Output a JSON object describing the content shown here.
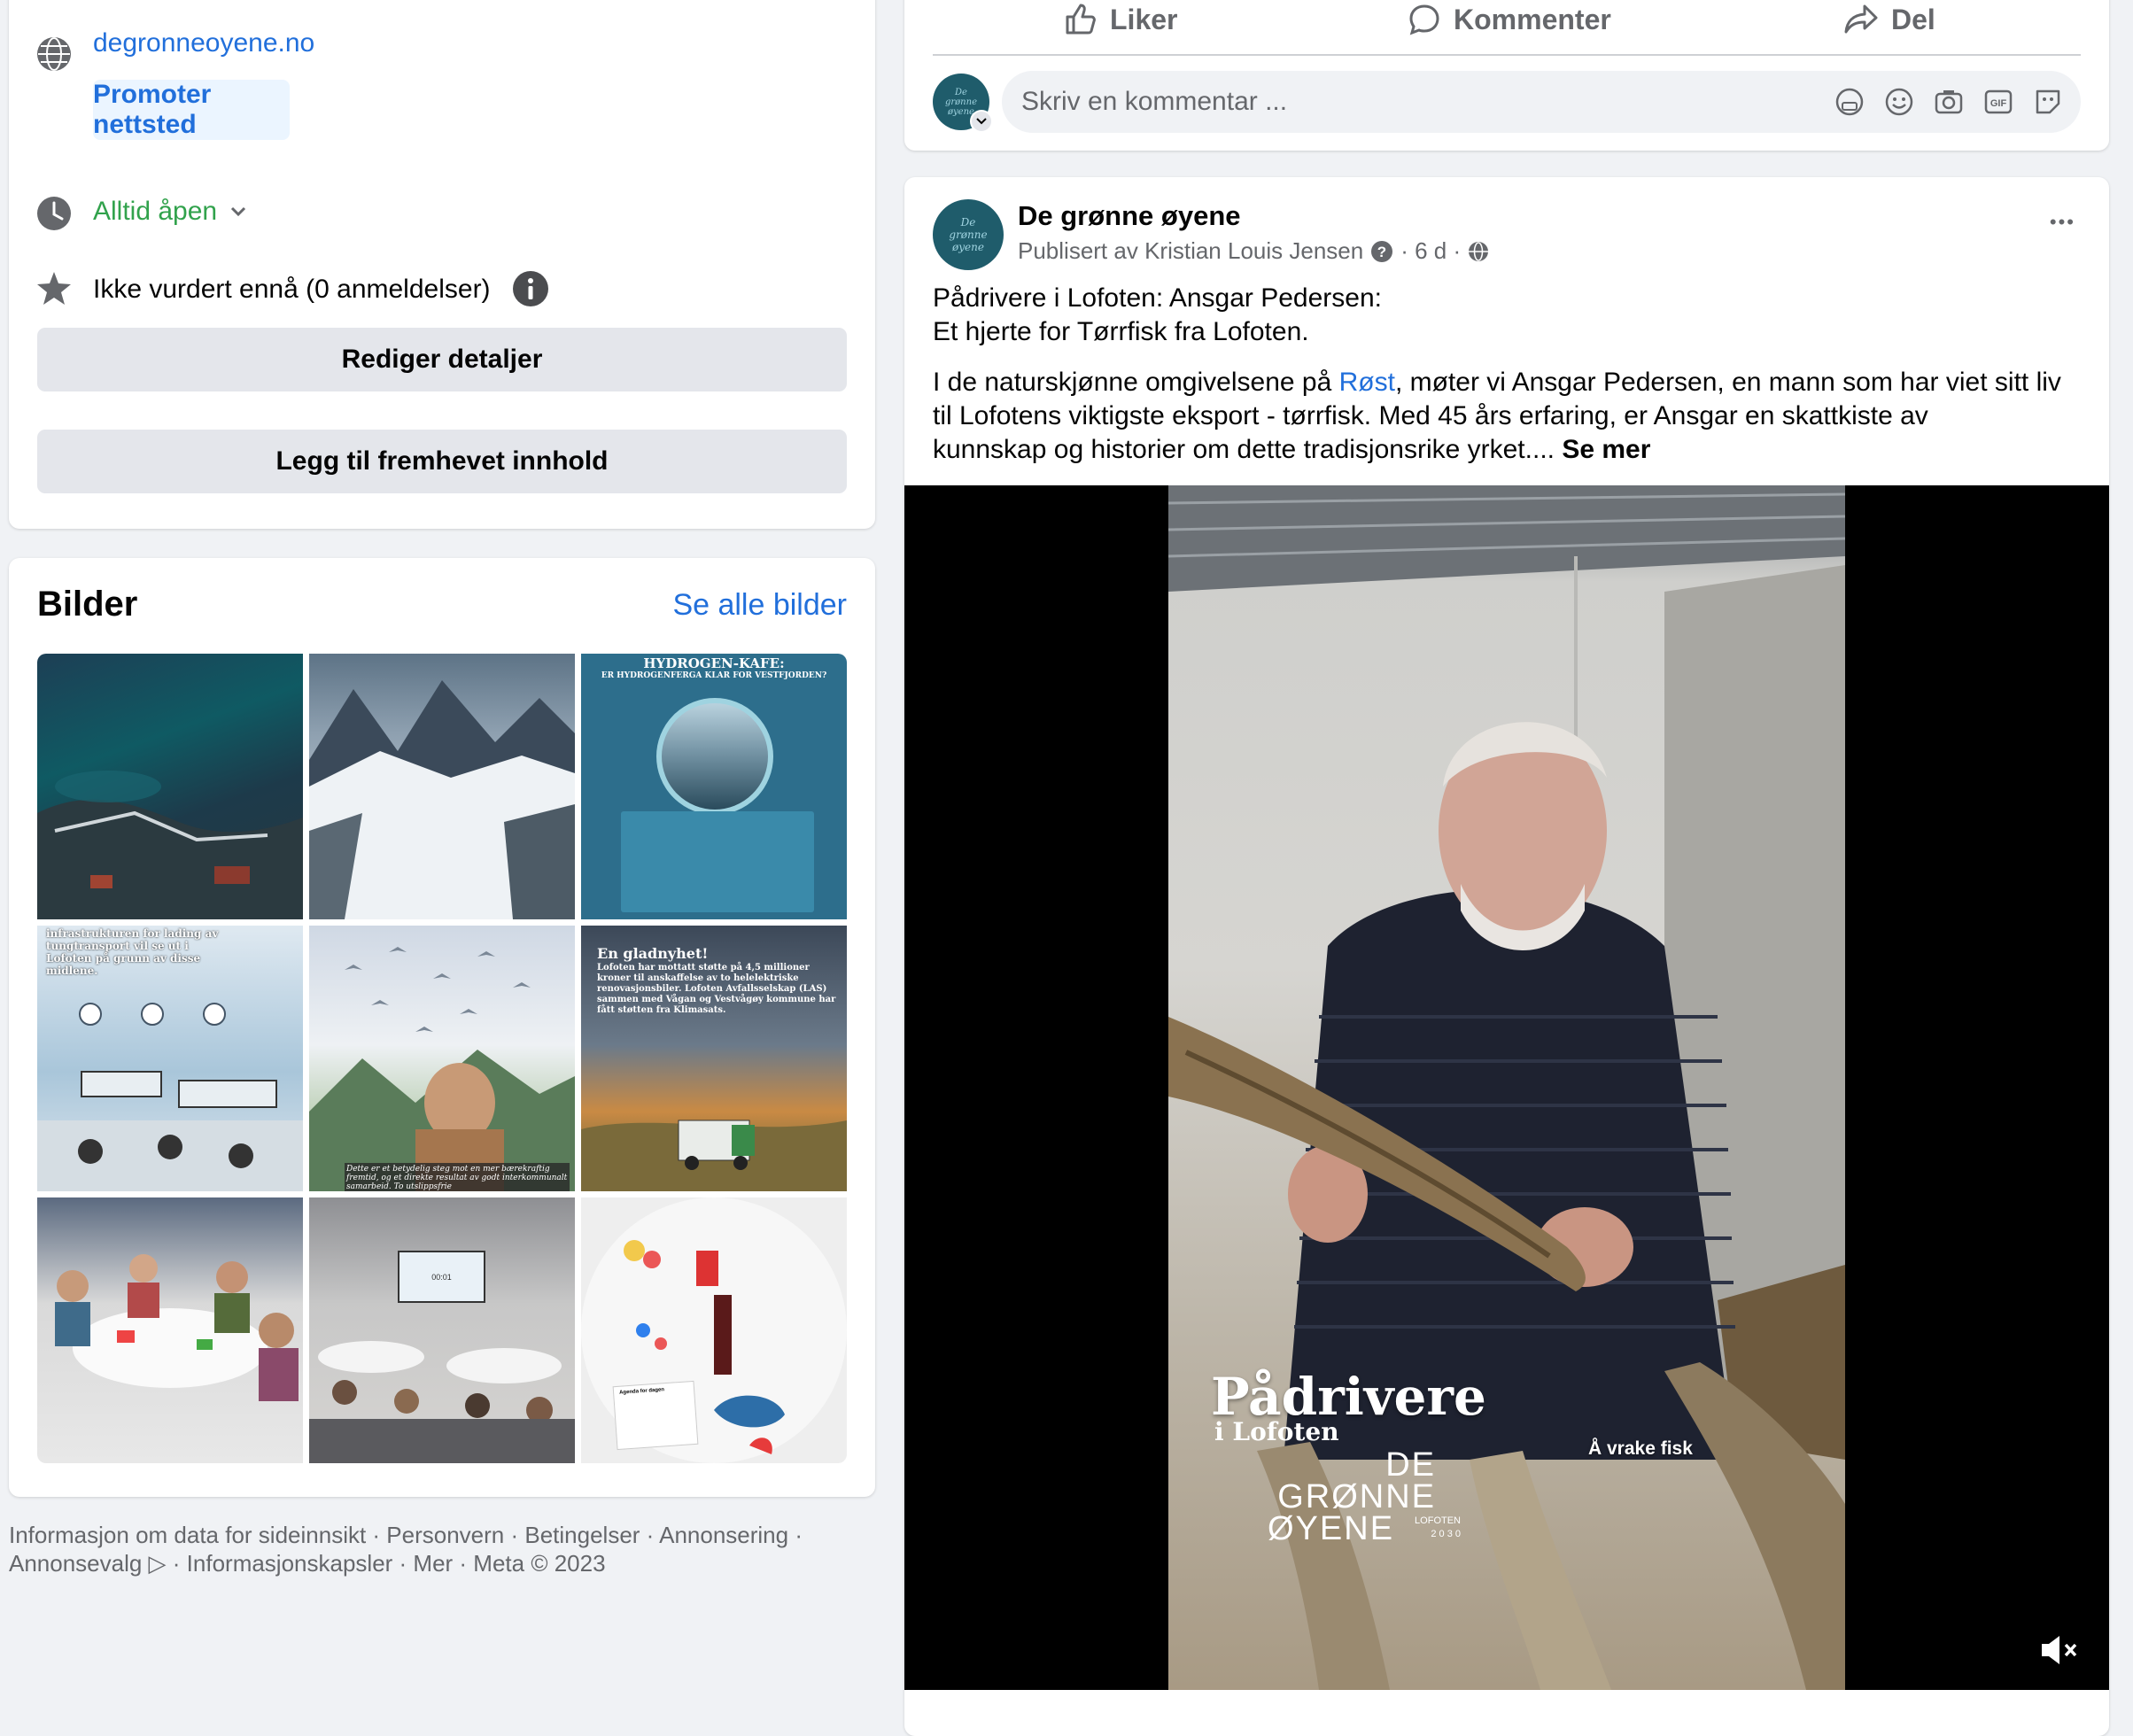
{
  "left_card": {
    "website": "degronneoyene.no",
    "promote_label": "Promoter nettsted",
    "hours": "Alltid åpen",
    "rating": "Ikke vurdert ennå (0 anmeldelser)",
    "edit_details": "Rediger detaljer",
    "add_featured": "Legg til fremhevet innhold"
  },
  "photos": {
    "title": "Bilder",
    "see_all": "Se alle bilder",
    "tiles": [
      {
        "kind": "aerial-island-photo"
      },
      {
        "kind": "snowy-mountains-photo"
      },
      {
        "kind": "poster",
        "headline": "HYDROGEN-KAFE:",
        "sub": "ER HYDROGENFERGA KLAR FOR VESTFJORDEN?"
      },
      {
        "kind": "illustration",
        "text": "infrastrukturen for lading av tungtransport vil se ut i Lofoten på grunn av disse midlene."
      },
      {
        "kind": "illustration-birds",
        "caption": "Dette er et betydelig steg mot en mer bærekraftig fremtid, og et direkte resultat av godt interkommunalt samarbeid. To utslippsfrie"
      },
      {
        "kind": "illustration",
        "headline": "En gladnyhet!",
        "text": "Lofoten har mottatt støtte på 4,5 millioner kroner til anskaffelse av to helelektriske renovasjonsbiler. Lofoten Avfallsselskap (LAS) sammen med Vågan og Vestvågøy kommune har fått støtten fra Klimasats."
      },
      {
        "kind": "workshop-photo"
      },
      {
        "kind": "presentation-photo",
        "screen_text": "00:01"
      },
      {
        "kind": "table-photo",
        "sheet_text": "Agenda for dagen"
      }
    ]
  },
  "footer": {
    "line1": "Informasjon om data for sideinnsikt · Personvern · Betingelser · Annonsering ·",
    "line2": "Annonsevalg ▷ · Informasjonskapsler · Mer · Meta © 2023"
  },
  "prev_post": {
    "like": "Liker",
    "comment": "Kommenter",
    "share": "Del",
    "comment_placeholder": "Skriv en kommentar ..."
  },
  "post": {
    "page_name": "De grønne øyene",
    "avatar_text": "De grønne øyene",
    "published_by": "Publisert av Kristian Louis Jensen",
    "age": "· 6 d ·",
    "headline1": "Pådrivere i Lofoten: Ansgar Pedersen:",
    "headline2": "Et hjerte for Tørrfisk fra Lofoten.",
    "body_pre": "I de naturskjønne omgivelsene på ",
    "body_link": "Røst",
    "body_post1": ", møter vi Ansgar Pedersen, en mann som har viet sitt liv",
    "body_line2": "til Lofotens viktigste eksport - tørrfisk. Med 45 års erfaring, er Ansgar en skattkiste av",
    "body_line3": "kunnskap og historier om dette tradisjonsrike yrket....",
    "see_more": "Se mer",
    "more_dots": "•••",
    "video": {
      "title1": "Pådrivere",
      "title2": "i Lofoten",
      "logo1": "DE",
      "logo2": "GRØNNE",
      "logo3": "ØYENE",
      "logo_small1": "LOFOTEN",
      "logo_small2": "2 0 3 0",
      "caption": "Å vrake fisk"
    }
  },
  "colors": {
    "link": "#216fdb",
    "green": "#31a24c",
    "page_bg": "#f0f2f5",
    "avatar": "#1f5c6b"
  }
}
